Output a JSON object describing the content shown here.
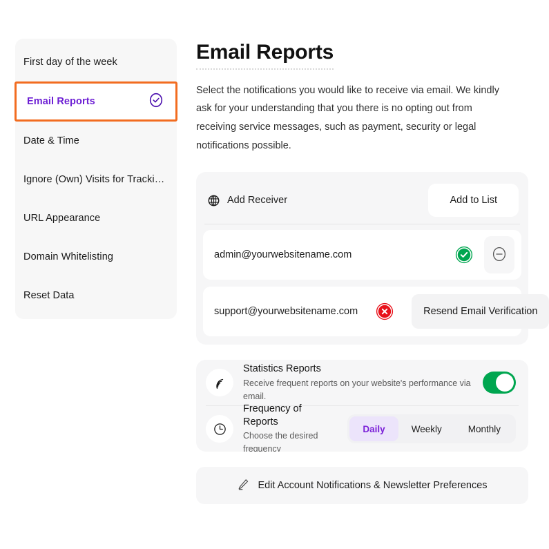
{
  "sidebar": {
    "items": [
      {
        "label": "First day of the week",
        "selected": false,
        "icon": ""
      },
      {
        "label": "Email Reports",
        "selected": true,
        "icon": "check-circle-icon"
      },
      {
        "label": "Date & Time",
        "selected": false,
        "icon": ""
      },
      {
        "label": "Ignore (Own) Visits for Tracking b...",
        "selected": false,
        "icon": ""
      },
      {
        "label": "URL Appearance",
        "selected": false,
        "icon": ""
      },
      {
        "label": "Domain Whitelisting",
        "selected": false,
        "icon": ""
      },
      {
        "label": "Reset Data",
        "selected": false,
        "icon": ""
      }
    ]
  },
  "main": {
    "title": "Email Reports",
    "intro": "Select the notifications you would like to receive via email. We kindly ask for your understanding that you there is no opting out from receiving service messages, such as payment, security or legal notifications possible.",
    "receivers": {
      "add_icon": "globe-icon",
      "add_placeholder": "Add Receiver",
      "add_value": "",
      "add_button_label": "Add to List",
      "rows": [
        {
          "email": "admin@yourwebsitename.com",
          "status": "verified",
          "status_icon": "check-badge-icon",
          "action_label": "",
          "remove_icon": "minus-circle-icon"
        },
        {
          "email": "support@yourwebsitename.com",
          "status": "unverified",
          "status_icon": "x-badge-icon",
          "action_label": "Resend Email Verification",
          "remove_icon": "minus-circle-icon"
        }
      ]
    },
    "settings": {
      "statistics": {
        "icon": "broadcast-icon",
        "title": "Statistics Reports",
        "subtitle": "Receive frequent reports on your website's performance via email.",
        "toggle_on": true
      },
      "frequency": {
        "icon": "clock-icon",
        "title": "Frequency of Reports",
        "subtitle": "Choose the desired frequency",
        "options": [
          "Daily",
          "Weekly",
          "Monthly"
        ],
        "selected": "Daily"
      }
    },
    "edit_preferences": {
      "icon": "pencil-icon",
      "label": "Edit Account Notifications & Newsletter Preferences"
    }
  },
  "colors": {
    "accent_purple": "#6d1fd4",
    "highlight_orange": "#f26c20",
    "success_green": "#00a650",
    "error_red": "#e8121b",
    "sidebar_bg": "#f7f7f7",
    "card_bg": "#f6f6f7"
  }
}
